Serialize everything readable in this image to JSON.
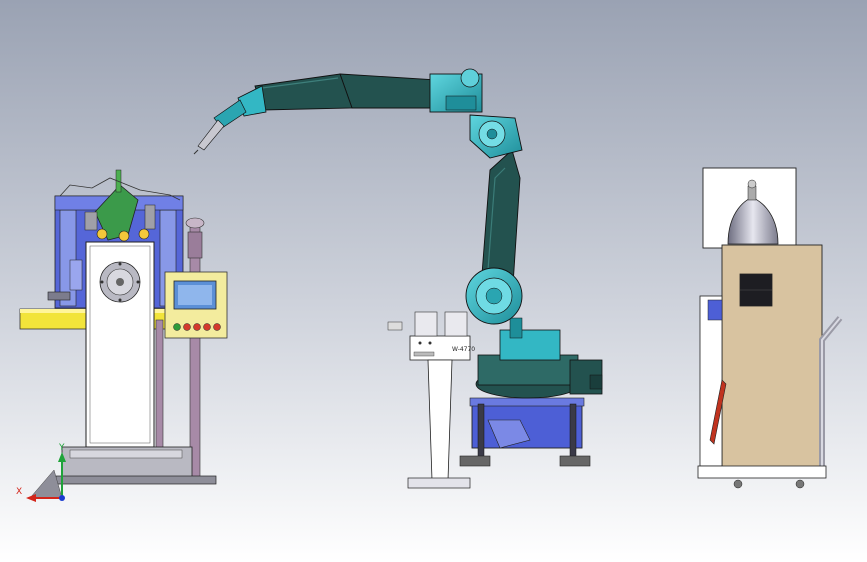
{
  "colors": {
    "bg_top": "#9aa2b3",
    "bg_bottom": "#ffffff",
    "robot_dark": "#23524f",
    "robot_cyan": "#33b7c4",
    "yellow_table": "#f2e43a",
    "panel_beige": "#f3ec9e",
    "cabinet_tan": "#d8c3a0",
    "blue_frame": "#4d5fd6",
    "pipe_purple": "#a78aa7",
    "hose_red": "#c0331f"
  },
  "controller": {
    "model_text": "W-4770"
  },
  "triad": {
    "x_label": "X",
    "y_label": "Y"
  }
}
